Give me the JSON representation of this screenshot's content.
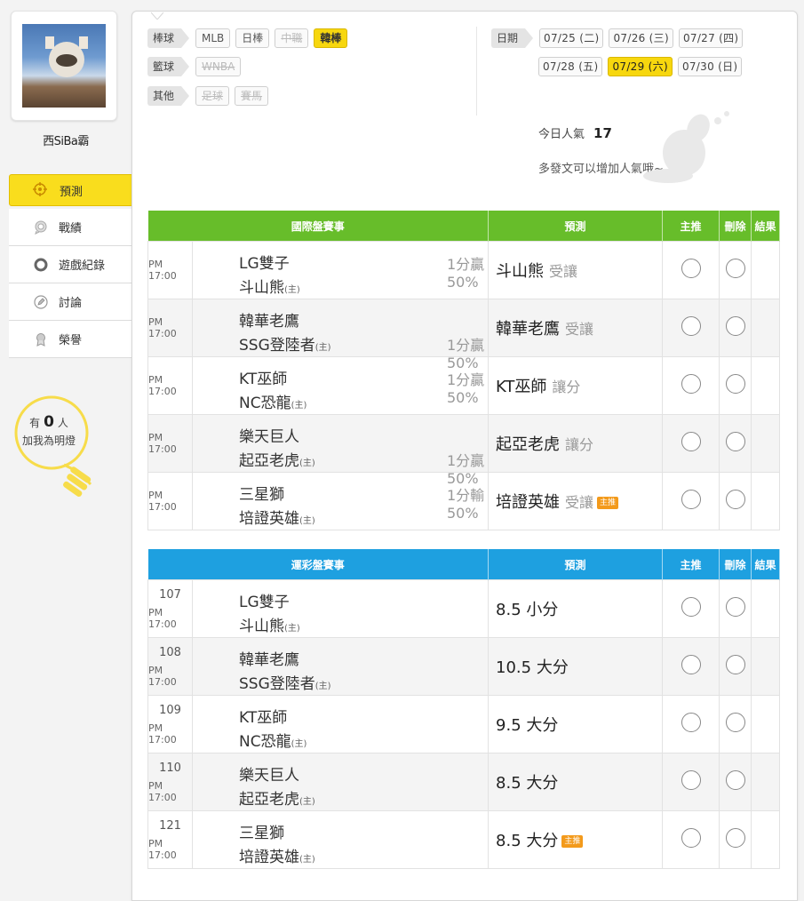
{
  "user": {
    "name": "西SiBa霸"
  },
  "nav": {
    "items": [
      {
        "label": "預測",
        "icon": "target-icon",
        "active": true
      },
      {
        "label": "戰績",
        "icon": "chat-bubble-icon"
      },
      {
        "label": "遊戲紀錄",
        "icon": "circle-icon"
      },
      {
        "label": "討論",
        "icon": "pencil-circle-icon"
      },
      {
        "label": "榮譽",
        "icon": "medal-icon"
      }
    ]
  },
  "fans": {
    "prefix": "有",
    "count": "0",
    "unit": "人",
    "caption": "加我為明燈"
  },
  "sports": {
    "baseball": {
      "label": "棒球",
      "tags": [
        "MLB",
        "日棒",
        "中職",
        "韓棒"
      ]
    },
    "basketball": {
      "label": "籃球",
      "tags": [
        "WNBA"
      ]
    },
    "other": {
      "label": "其他",
      "tags": [
        "足球",
        "賽馬"
      ]
    }
  },
  "dates": {
    "label": "日期",
    "row1": [
      "07/25 (二)",
      "07/26 (三)",
      "07/27 (四)"
    ],
    "row2": [
      "07/28 (五)",
      "07/29 (六)",
      "07/30 (日)"
    ]
  },
  "popularity": {
    "label": "今日人氣",
    "value": "17",
    "hint": "多發文可以增加人氣哦~"
  },
  "intl": {
    "headers": {
      "event": "國際盤賽事",
      "pick": "預測",
      "main": "主推",
      "delete": "刪除",
      "result": "結果"
    },
    "rows": [
      {
        "time": "PM 17:00",
        "away": "LG雙子",
        "home": "斗山熊",
        "home_mark": "(主)",
        "odds": "1分贏50%",
        "odds_pos": "top",
        "pick": "斗山熊",
        "side": "受讓",
        "badge": ""
      },
      {
        "time": "PM 17:00",
        "away": "韓華老鷹",
        "home": "SSG登陸者",
        "home_mark": "(主)",
        "odds": "1分贏50%",
        "odds_pos": "bottom",
        "pick": "韓華老鷹",
        "side": "受讓",
        "badge": ""
      },
      {
        "time": "PM 17:00",
        "away": "KT巫師",
        "home": "NC恐龍",
        "home_mark": "(主)",
        "odds": "1分贏50%",
        "odds_pos": "top",
        "pick": "KT巫師",
        "side": "讓分",
        "badge": ""
      },
      {
        "time": "PM 17:00",
        "away": "樂天巨人",
        "home": "起亞老虎",
        "home_mark": "(主)",
        "odds": "1分贏50%",
        "odds_pos": "bottom",
        "pick": "起亞老虎",
        "side": "讓分",
        "badge": ""
      },
      {
        "time": "PM 17:00",
        "away": "三星獅",
        "home": "培證英雄",
        "home_mark": "(主)",
        "odds": "1分輸50%",
        "odds_pos": "top",
        "pick": "培證英雄",
        "side": "受讓",
        "badge": "主推"
      }
    ]
  },
  "sportslottery": {
    "headers": {
      "event": "運彩盤賽事",
      "pick": "預測",
      "main": "主推",
      "delete": "刪除",
      "result": "結果"
    },
    "rows": [
      {
        "code": "107",
        "time": "PM 17:00",
        "away": "LG雙子",
        "home": "斗山熊",
        "home_mark": "(主)",
        "pick": "8.5 小分",
        "badge": ""
      },
      {
        "code": "108",
        "time": "PM 17:00",
        "away": "韓華老鷹",
        "home": "SSG登陸者",
        "home_mark": "(主)",
        "pick": "10.5 大分",
        "badge": ""
      },
      {
        "code": "109",
        "time": "PM 17:00",
        "away": "KT巫師",
        "home": "NC恐龍",
        "home_mark": "(主)",
        "pick": "9.5 大分",
        "badge": ""
      },
      {
        "code": "110",
        "time": "PM 17:00",
        "away": "樂天巨人",
        "home": "起亞老虎",
        "home_mark": "(主)",
        "pick": "8.5 大分",
        "badge": ""
      },
      {
        "code": "121",
        "time": "PM 17:00",
        "away": "三星獅",
        "home": "培證英雄",
        "home_mark": "(主)",
        "pick": "8.5 大分",
        "badge": "主推"
      }
    ]
  },
  "colors": {
    "accent": "#f7d70e",
    "intl_header": "#67bd2a",
    "lottery_header": "#1ea0e0",
    "badge": "#f39a1b"
  }
}
